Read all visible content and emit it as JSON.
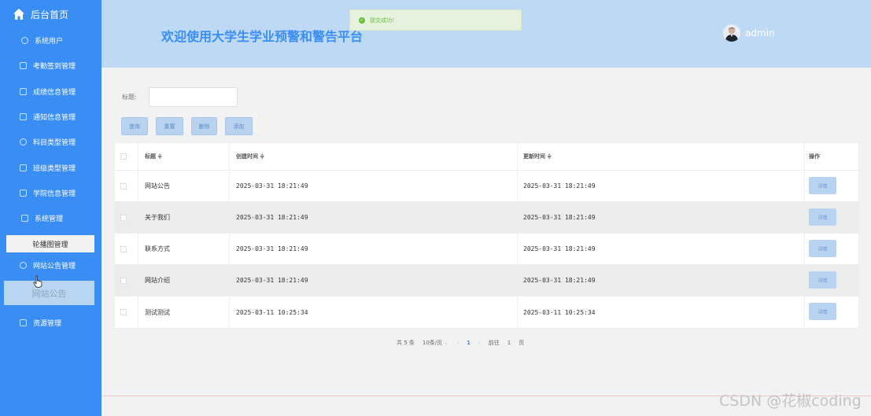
{
  "sidebar": {
    "home_label": "后台首页",
    "items": [
      {
        "label": "系统用户",
        "icon": "cloud-icon"
      },
      {
        "label": "考勤签到管理",
        "icon": "edit-icon"
      },
      {
        "label": "成绩信息管理",
        "icon": "message-icon"
      },
      {
        "label": "通知信息管理",
        "icon": "edit-icon"
      },
      {
        "label": "科目类型管理",
        "icon": "cloud-icon"
      },
      {
        "label": "班级类型管理",
        "icon": "message-icon"
      },
      {
        "label": "学院信息管理",
        "icon": "document-icon"
      },
      {
        "label": "系统管理",
        "icon": "edit-icon"
      },
      {
        "label": "轮播图管理",
        "icon": ""
      },
      {
        "label": "网站公告管理",
        "icon": "cloud-icon"
      },
      {
        "label": "网站公告",
        "icon": ""
      },
      {
        "label": "资源管理",
        "icon": "edit-icon"
      }
    ]
  },
  "header": {
    "title": "欢迎使用大学生学业预警和警告平台",
    "username": "admin"
  },
  "toast": {
    "message": "提交成功!"
  },
  "search": {
    "label": "标题:",
    "value": ""
  },
  "buttons": {
    "query": "查询",
    "reset": "重置",
    "delete": "删除",
    "add": "添加"
  },
  "table": {
    "columns": [
      "标题 ≑",
      "创建时间 ≑",
      "更新时间 ≑",
      "操作"
    ],
    "rows": [
      {
        "title": "网站公告",
        "created": "2025-03-31 18:21:49",
        "updated": "2025-03-31 18:21:49",
        "action": "详情"
      },
      {
        "title": "关于我们",
        "created": "2025-03-31 18:21:49",
        "updated": "2025-03-31 18:21:49",
        "action": "详情"
      },
      {
        "title": "联系方式",
        "created": "2025-03-31 18:21:49",
        "updated": "2025-03-31 18:21:49",
        "action": "详情"
      },
      {
        "title": "网站介绍",
        "created": "2025-03-31 18:21:49",
        "updated": "2025-03-31 18:21:49",
        "action": "详情"
      },
      {
        "title": "测试测试",
        "created": "2025-03-11 10:25:34",
        "updated": "2025-03-11 10:25:34",
        "action": "详情"
      }
    ]
  },
  "pagination": {
    "total": "共 5 条",
    "page_size": "10条/页",
    "dropdown": "⌄",
    "prev": "‹",
    "current_page": "1",
    "next": "›",
    "goto_prefix": "前往",
    "goto_value": "1",
    "goto_suffix": "页"
  },
  "watermark": "CSDN @花椒coding"
}
